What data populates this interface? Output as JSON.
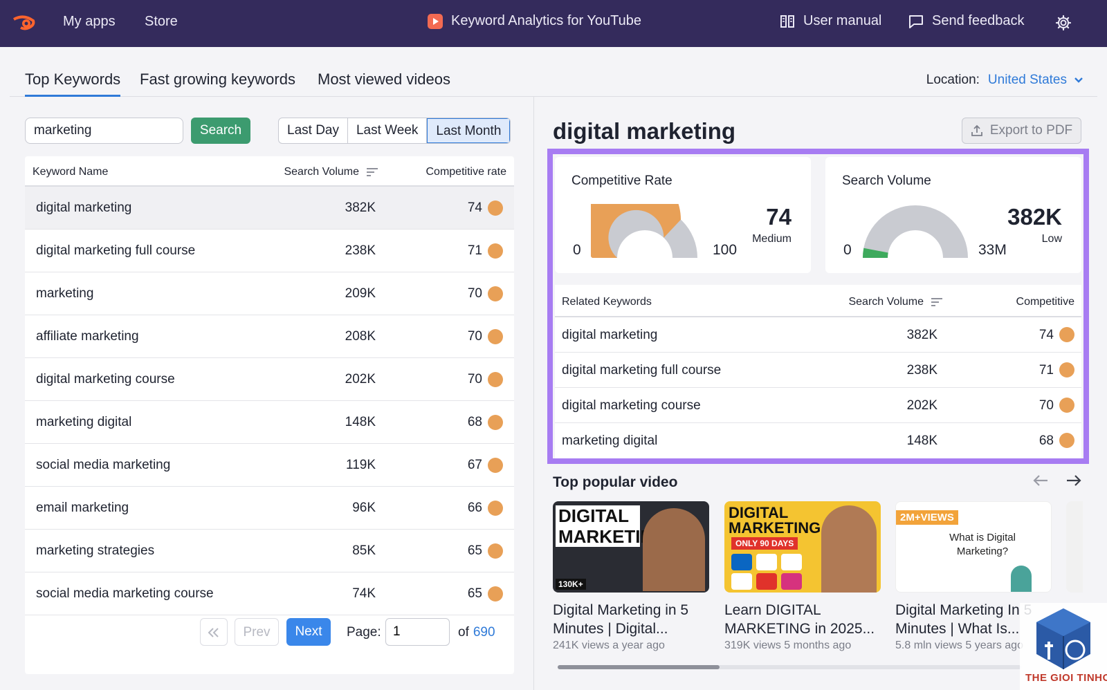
{
  "topbar": {
    "my_apps": "My apps",
    "store": "Store",
    "app_title": "Keyword Analytics for YouTube",
    "user_manual": "User manual",
    "send_feedback": "Send feedback"
  },
  "tabs": [
    {
      "label": "Top Keywords",
      "active": true
    },
    {
      "label": "Fast growing keywords",
      "active": false
    },
    {
      "label": "Most viewed videos",
      "active": false
    }
  ],
  "location": {
    "label": "Location:",
    "value": "United States"
  },
  "search": {
    "value": "marketing",
    "button": "Search"
  },
  "period": [
    "Last Day",
    "Last Week",
    "Last Month"
  ],
  "period_selected": "Last Month",
  "keyword_table": {
    "headers": [
      "Keyword Name",
      "Search Volume",
      "Competitive rate"
    ],
    "rows": [
      {
        "name": "digital marketing",
        "volume": "382K",
        "rate": "74"
      },
      {
        "name": "digital marketing full course",
        "volume": "238K",
        "rate": "71"
      },
      {
        "name": "marketing",
        "volume": "209K",
        "rate": "70"
      },
      {
        "name": "affiliate marketing",
        "volume": "208K",
        "rate": "70"
      },
      {
        "name": "digital marketing course",
        "volume": "202K",
        "rate": "70"
      },
      {
        "name": "marketing digital",
        "volume": "148K",
        "rate": "68"
      },
      {
        "name": "social media marketing",
        "volume": "119K",
        "rate": "67"
      },
      {
        "name": "email marketing",
        "volume": "96K",
        "rate": "66"
      },
      {
        "name": "marketing strategies",
        "volume": "85K",
        "rate": "65"
      },
      {
        "name": "social media marketing course",
        "volume": "74K",
        "rate": "65"
      }
    ]
  },
  "pagination": {
    "prev": "Prev",
    "next": "Next",
    "page_label": "Page:",
    "page": "1",
    "of": "of",
    "total": "690"
  },
  "detail": {
    "keyword": "digital marketing",
    "export": "Export to PDF",
    "competitive_rate": {
      "title": "Competitive Rate",
      "min": "0",
      "max": "100",
      "value": "74",
      "level": "Medium",
      "fraction": 0.74
    },
    "search_volume": {
      "title": "Search Volume",
      "min": "0",
      "max": "33M",
      "value": "382K",
      "level": "Low",
      "fraction": 0.06
    }
  },
  "related_table": {
    "headers": [
      "Related Keywords",
      "Search Volume",
      "Competitive"
    ],
    "rows": [
      {
        "name": "digital marketing",
        "volume": "382K",
        "rate": "74"
      },
      {
        "name": "digital marketing full course",
        "volume": "238K",
        "rate": "71"
      },
      {
        "name": "digital marketing course",
        "volume": "202K",
        "rate": "70"
      },
      {
        "name": "marketing digital",
        "volume": "148K",
        "rate": "68"
      }
    ]
  },
  "popular": {
    "title": "Top popular video",
    "videos": [
      {
        "title": "Digital Marketing in 5 Minutes | Digital...",
        "meta": "241K views a year ago",
        "thumb_text": "DIGITAL MARKETING",
        "thumb_badge": "130K+"
      },
      {
        "title": "Learn DIGITAL MARKETING in 2025...",
        "meta": "319K views 5 months ago",
        "thumb_text": "DIGITAL MARKETING",
        "thumb_badge": "ONLY 90 DAYS"
      },
      {
        "title": "Digital Marketing In 5 Minutes | What Is...",
        "meta": "5.8 mln views 5 years ago",
        "thumb_text": "What is Digital Marketing?",
        "thumb_badge": "2M+VIEWS"
      }
    ]
  },
  "colors": {
    "topbar": "#342b5c",
    "accent": "#2f7ad8",
    "search": "#3c9b6f",
    "orange": "#e8a057",
    "gray": "#c9cbd1",
    "green": "#3eaa5d",
    "highlight": "#a77cf2"
  },
  "watermark": "THE GIOI TINHOC"
}
